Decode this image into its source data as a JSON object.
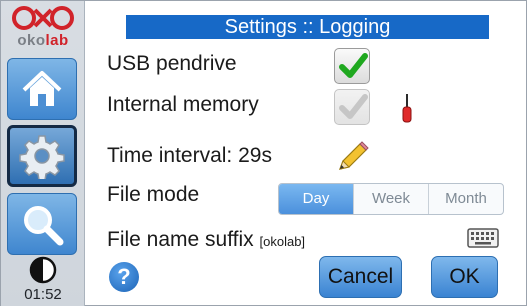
{
  "window": {
    "title": "Settings :: Logging"
  },
  "sidebar": {
    "logo_text_prefix": "oko",
    "logo_text_suffix": "lab",
    "items": [
      {
        "name": "home",
        "icon": "home-icon",
        "active": false
      },
      {
        "name": "settings",
        "icon": "gear-icon",
        "active": true
      },
      {
        "name": "search",
        "icon": "magnifier-icon",
        "active": false
      }
    ],
    "contrast_icon": "contrast-icon",
    "clock": "01:52"
  },
  "settings": {
    "usb_pendrive": {
      "label": "USB pendrive",
      "checked": true,
      "enabled": true
    },
    "internal_memory": {
      "label": "Internal memory",
      "checked": true,
      "enabled": false,
      "side_icon": "screwdriver-icon"
    },
    "time_interval": {
      "label": "Time interval: 29s",
      "edit_icon": "pencil-icon"
    },
    "file_mode": {
      "label": "File mode",
      "options": [
        "Day",
        "Week",
        "Month"
      ],
      "selected": "Day"
    },
    "file_name_suffix": {
      "label": "File name suffix",
      "value": "[okolab]",
      "edit_icon": "keyboard-icon"
    }
  },
  "footer": {
    "help_label": "?",
    "cancel_label": "Cancel",
    "ok_label": "OK"
  },
  "colors": {
    "title_bar": "#1769c7",
    "button": "#4b90dc",
    "check_green": "#1fa81f",
    "brand_red": "#d1232a"
  }
}
